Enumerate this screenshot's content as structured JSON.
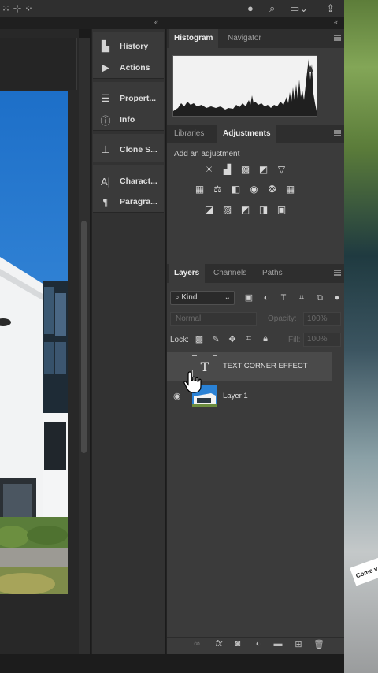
{
  "topbar": {
    "icons": [
      "move-options-icon",
      "align-icon",
      "user-icon",
      "search-icon",
      "workspace-icon",
      "share-icon"
    ]
  },
  "dock": {
    "items": [
      {
        "label": "History",
        "icon": "history-icon"
      },
      {
        "label": "Actions",
        "icon": "play-icon"
      },
      {
        "label": "Propert...",
        "icon": "properties-icon"
      },
      {
        "label": "Info",
        "icon": "info-icon"
      },
      {
        "label": "Clone S...",
        "icon": "clone-source-icon"
      },
      {
        "label": "Charact...",
        "icon": "character-icon"
      },
      {
        "label": "Paragra...",
        "icon": "paragraph-icon"
      }
    ]
  },
  "panels": {
    "histogram_tabs": [
      "Histogram",
      "Navigator"
    ],
    "adjustment_tabs": [
      "Libraries",
      "Adjustments"
    ],
    "adjustments_label": "Add an adjustment",
    "layers_tabs": [
      "Layers",
      "Channels",
      "Paths"
    ]
  },
  "layers": {
    "filter": "Kind",
    "blend_mode": "Normal",
    "opacity_label": "Opacity:",
    "opacity_value": "100%",
    "lock_label": "Lock:",
    "fill_label": "Fill:",
    "fill_value": "100%",
    "items": [
      {
        "name": "TEXT CORNER EFFECT",
        "type": "text"
      },
      {
        "name": "Layer 1",
        "type": "image"
      }
    ]
  },
  "sticker_text": "Come v"
}
